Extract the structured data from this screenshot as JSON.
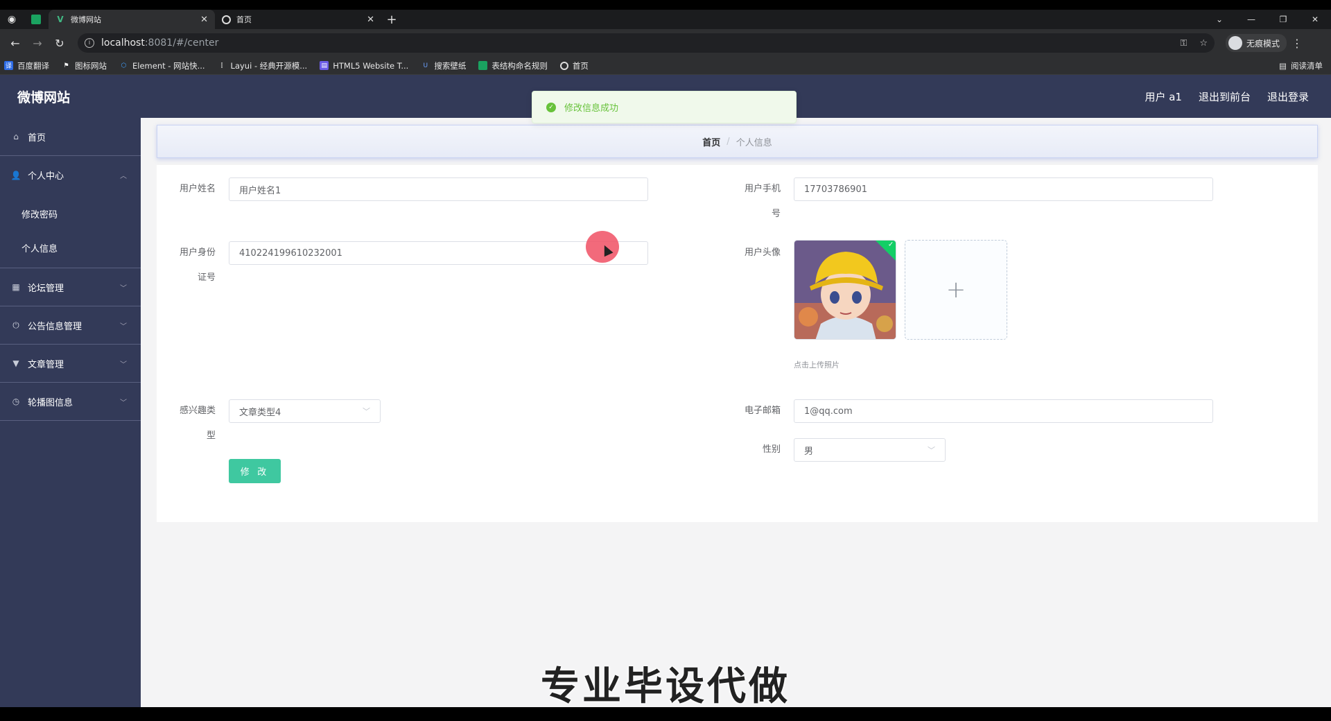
{
  "browser": {
    "tabs": [
      {
        "title": "微博网站",
        "active": true
      },
      {
        "title": "首页",
        "active": false
      }
    ],
    "url_host": "localhost",
    "url_path": ":8081/#/center",
    "profile_label": "无痕模式",
    "bookmarks": [
      "百度翻译",
      "图标网站",
      "Element - 网站快...",
      "Layui - 经典开源模...",
      "HTML5 Website T...",
      "搜索壁纸",
      "表结构命名规则",
      "首页"
    ],
    "reading_list": "阅读清单"
  },
  "app": {
    "brand": "微博网站",
    "header_links": {
      "user": "用户 a1",
      "front": "退出到前台",
      "logout": "退出登录"
    },
    "sidebar": {
      "home": "首页",
      "personal_center": "个人中心",
      "change_password": "修改密码",
      "personal_info": "个人信息",
      "forum": "论坛管理",
      "notice": "公告信息管理",
      "article": "文章管理",
      "carousel": "轮播图信息"
    },
    "breadcrumb": {
      "home": "首页",
      "separator": "/",
      "current": "个人信息"
    },
    "form": {
      "name_label": "用户姓名",
      "name_value": "用户姓名1",
      "phone_label_1": "用户手机",
      "phone_label_2": "号",
      "phone_value": "17703786901",
      "idcard_label_1": "用户身份",
      "idcard_label_2": "证号",
      "idcard_value": "410224199610232001",
      "avatar_label": "用户头像",
      "upload_hint": "点击上传照片",
      "upload_plus": "+",
      "interest_label_1": "感兴趣类",
      "interest_label_2": "型",
      "interest_value": "文章类型4",
      "email_label": "电子邮箱",
      "email_value": "1@qq.com",
      "gender_label": "性别",
      "gender_value": "男",
      "submit_label": "修 改"
    },
    "toast": "修改信息成功",
    "watermark": "专业毕设代做"
  },
  "colors": {
    "header_bg": "#333a58",
    "accent_green": "#3fc8a0",
    "success": "#67c23a"
  }
}
